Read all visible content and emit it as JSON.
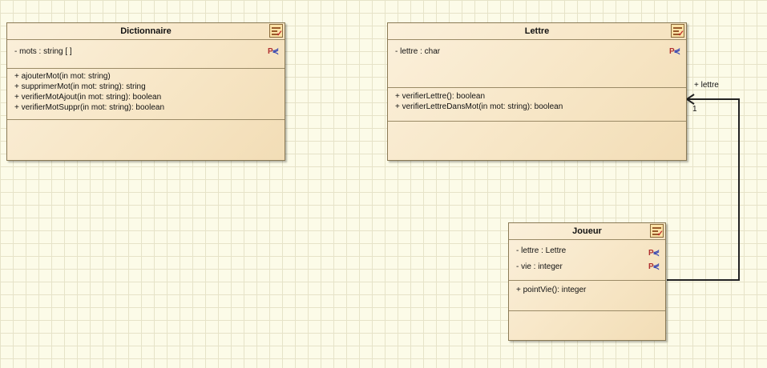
{
  "classes": {
    "dictionnaire": {
      "name": "Dictionnaire",
      "attributes": [
        "- mots : string [ ]"
      ],
      "operations": [
        "+ ajouterMot(in mot: string)",
        "+ supprimerMot(in mot: string): string",
        "+ verifierMotAjout(in mot: string): boolean",
        "+ verifierMotSuppr(in mot: string): boolean"
      ]
    },
    "lettre": {
      "name": "Lettre",
      "attributes": [
        "- lettre : char"
      ],
      "operations": [
        "+ verifierLettre(): boolean",
        "+ verifierLettreDansMot(in mot: string): boolean"
      ]
    },
    "joueur": {
      "name": "Joueur",
      "attributes": [
        "- lettre : Lettre",
        "- vie : integer"
      ],
      "operations": [
        "+ pointVie(): integer"
      ]
    }
  },
  "association": {
    "role": "+ lettre",
    "multiplicity": "1"
  }
}
